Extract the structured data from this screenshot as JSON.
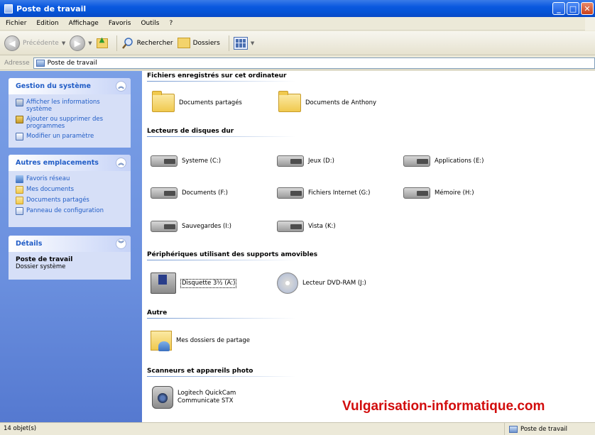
{
  "window": {
    "title": "Poste de travail"
  },
  "menu": [
    "Fichier",
    "Edition",
    "Affichage",
    "Favoris",
    "Outils",
    "?"
  ],
  "toolbar": {
    "back": "Précédente",
    "search": "Rechercher",
    "folders": "Dossiers"
  },
  "address": {
    "label": "Adresse",
    "value": "Poste de travail"
  },
  "tasks": {
    "system": {
      "title": "Gestion du système",
      "items": [
        "Afficher les informations système",
        "Ajouter ou supprimer des programmes",
        "Modifier un paramètre"
      ]
    },
    "places": {
      "title": "Autres emplacements",
      "items": [
        "Favoris réseau",
        "Mes documents",
        "Documents partagés",
        "Panneau de configuration"
      ]
    },
    "details": {
      "title": "Détails",
      "name": "Poste de travail",
      "type": "Dossier système"
    }
  },
  "groups": {
    "files": {
      "title": "Fichiers enregistrés sur cet ordinateur",
      "items": [
        "Documents partagés",
        "Documents de Anthony"
      ]
    },
    "drives": {
      "title": "Lecteurs de disques dur",
      "items": [
        "Systeme (C:)",
        "Jeux (D:)",
        "Applications (E:)",
        "Documents (F:)",
        "Fichiers Internet (G:)",
        "Mémoire (H:)",
        "Sauvegardes (I:)",
        "Vista (K:)"
      ]
    },
    "removable": {
      "title": "Périphériques utilisant des supports amovibles",
      "items": [
        "Disquette 3½ (A:)",
        "Lecteur DVD-RAM (J:)"
      ]
    },
    "other": {
      "title": "Autre",
      "items": [
        "Mes dossiers de partage"
      ]
    },
    "scanners": {
      "title": "Scanneurs et appareils photo",
      "items": [
        "Logitech QuickCam Communicate STX"
      ]
    }
  },
  "watermark": "Vulgarisation-informatique.com",
  "status": {
    "count": "14 objet(s)",
    "location": "Poste de travail"
  }
}
